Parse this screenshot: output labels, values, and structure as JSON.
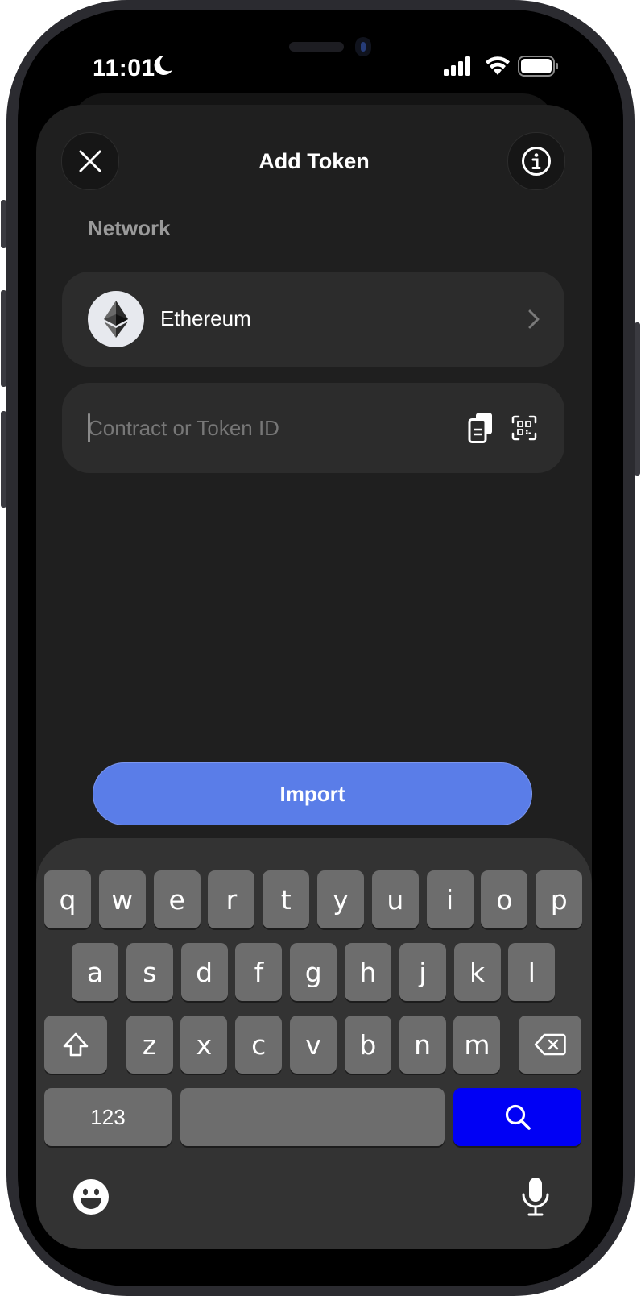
{
  "status_bar": {
    "time": "11:01",
    "icons": [
      "moon-icon",
      "cellular-signal-icon",
      "wifi-icon",
      "battery-icon"
    ]
  },
  "header": {
    "title": "Add Token",
    "close_icon": "close-icon",
    "info_icon": "info-icon"
  },
  "network": {
    "section_label": "Network",
    "selected_name": "Ethereum",
    "icon": "ethereum-logo",
    "chevron": "chevron-right-icon"
  },
  "contract_input": {
    "placeholder": "Contract or Token ID",
    "value": "",
    "paste_icon": "paste-icon",
    "scan_icon": "qr-scan-icon"
  },
  "actions": {
    "import_label": "Import"
  },
  "keyboard": {
    "row1": [
      "q",
      "w",
      "e",
      "r",
      "t",
      "y",
      "u",
      "i",
      "o",
      "p"
    ],
    "row2": [
      "a",
      "s",
      "d",
      "f",
      "g",
      "h",
      "j",
      "k",
      "l"
    ],
    "row3": [
      "z",
      "x",
      "c",
      "v",
      "b",
      "n",
      "m"
    ],
    "numbers_label": "123",
    "shift_icon": "shift-icon",
    "backspace_icon": "backspace-icon",
    "search_icon": "search-icon",
    "emoji_icon": "emoji-icon",
    "mic_icon": "microphone-icon"
  },
  "colors": {
    "accent": "#5a7de8",
    "search_key": "#0000f5",
    "sheet_bg": "#1f1f1f",
    "keyboard_bg": "#333333"
  }
}
